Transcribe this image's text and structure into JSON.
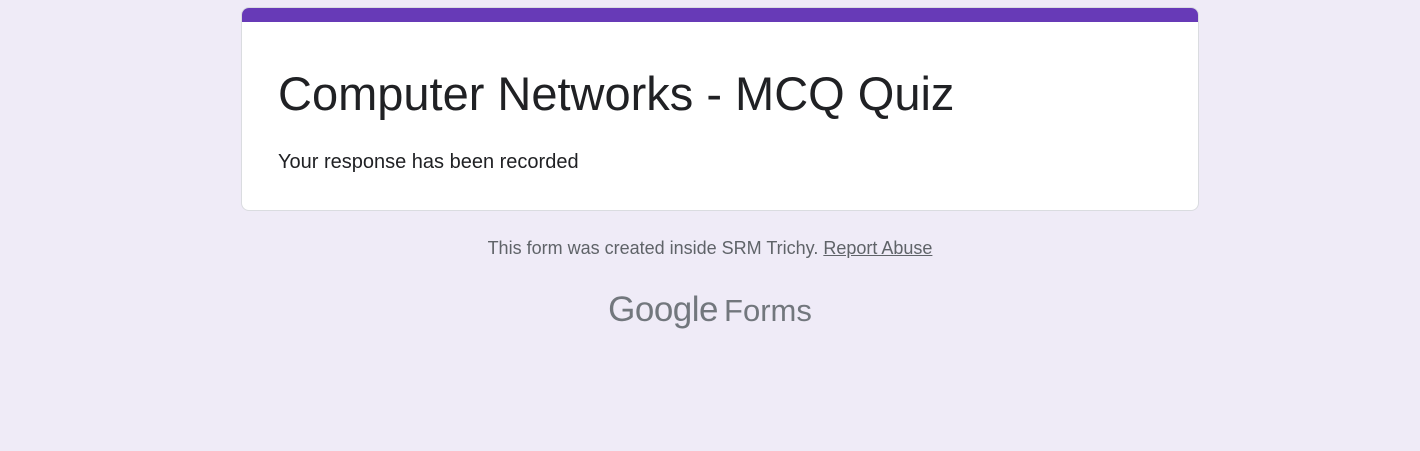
{
  "form": {
    "title": "Computer Networks - MCQ Quiz",
    "confirmation_message": "Your response has been recorded",
    "accent_color": "#673ab7"
  },
  "footer": {
    "note": "This form was created inside SRM Trichy.",
    "report_link": "Report Abuse"
  },
  "branding": {
    "google_word": "Google",
    "product_word": "Forms"
  },
  "page": {
    "background_color": "#efebf7"
  }
}
